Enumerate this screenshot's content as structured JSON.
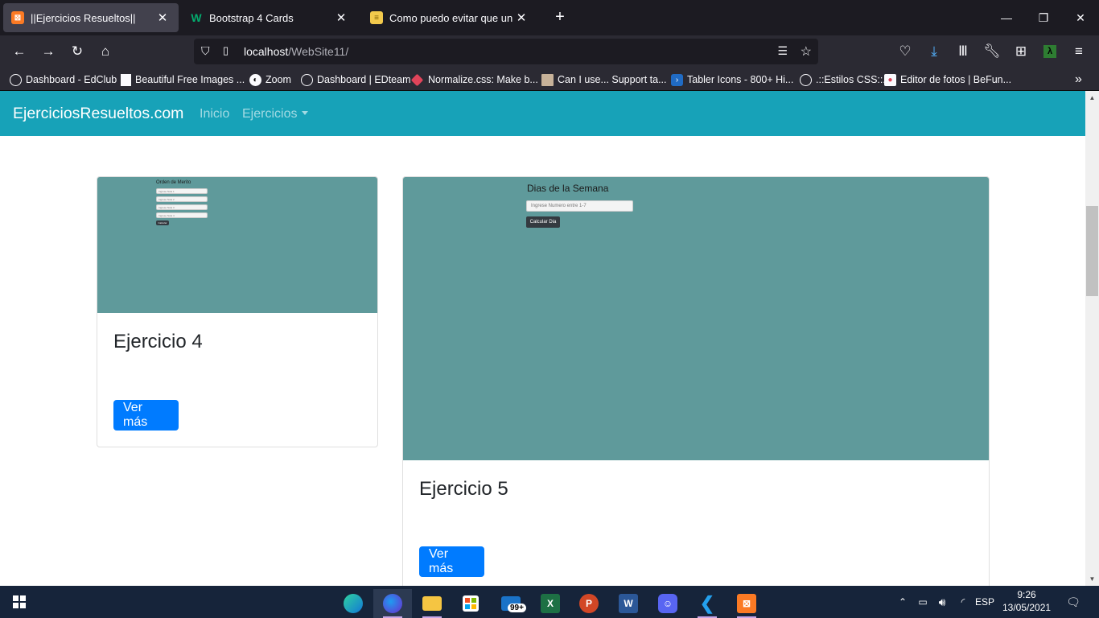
{
  "browser": {
    "tabs": [
      {
        "title": "||Ejercicios Resueltos||",
        "icon": "xampp-icon",
        "active": true
      },
      {
        "title": "Bootstrap 4 Cards",
        "icon": "w3-icon",
        "active": false
      },
      {
        "title": "Como puedo evitar que un card",
        "icon": "stackoverflow-icon",
        "active": false
      }
    ],
    "url_host": "localhost",
    "url_path": "/WebSite11/",
    "bookmarks": [
      {
        "label": "Dashboard - EdClub",
        "icon": "globe-icon"
      },
      {
        "label": "Beautiful Free Images ...",
        "icon": "unsplash-icon"
      },
      {
        "label": "Zoom",
        "icon": "zoom-icon"
      },
      {
        "label": "Dashboard | EDteam",
        "icon": "globe-icon"
      },
      {
        "label": "Normalize.css: Make b...",
        "icon": "normalize-icon"
      },
      {
        "label": "Can I use... Support ta...",
        "icon": "caniuse-icon"
      },
      {
        "label": "Tabler Icons - 800+ Hi...",
        "icon": "tabler-icon"
      },
      {
        "label": ".::Estilos CSS::.",
        "icon": "globe-icon"
      },
      {
        "label": "Editor de fotos | BeFun...",
        "icon": "befunky-icon"
      }
    ]
  },
  "site": {
    "brand": "EjerciciosResueltos.com",
    "nav": {
      "inicio": "Inicio",
      "ejercicios": "Ejercicios"
    }
  },
  "cards": [
    {
      "title": "Ejercicio 4",
      "button": "Ver más",
      "preview": {
        "heading": "Orden de Merito",
        "inputs": [
          "Ingrese Nota 1",
          "Ingrese Nota 2",
          "Ingrese Nota 3",
          "Ingrese Nota 4"
        ],
        "button": "Calcular"
      }
    },
    {
      "title": "Ejercicio 5",
      "button": "Ver más",
      "preview": {
        "heading": "Dias de la Semana",
        "input_placeholder": "Ingrese Numero entre 1-7",
        "button": "Calcular Dia"
      }
    }
  ],
  "taskbar": {
    "mail_badge": "99+",
    "language": "ESP",
    "time": "9:26",
    "date": "13/05/2021"
  },
  "colors": {
    "site_nav": "#17a2b8",
    "card_image": "#5f9a9b",
    "primary_button": "#007bff"
  }
}
